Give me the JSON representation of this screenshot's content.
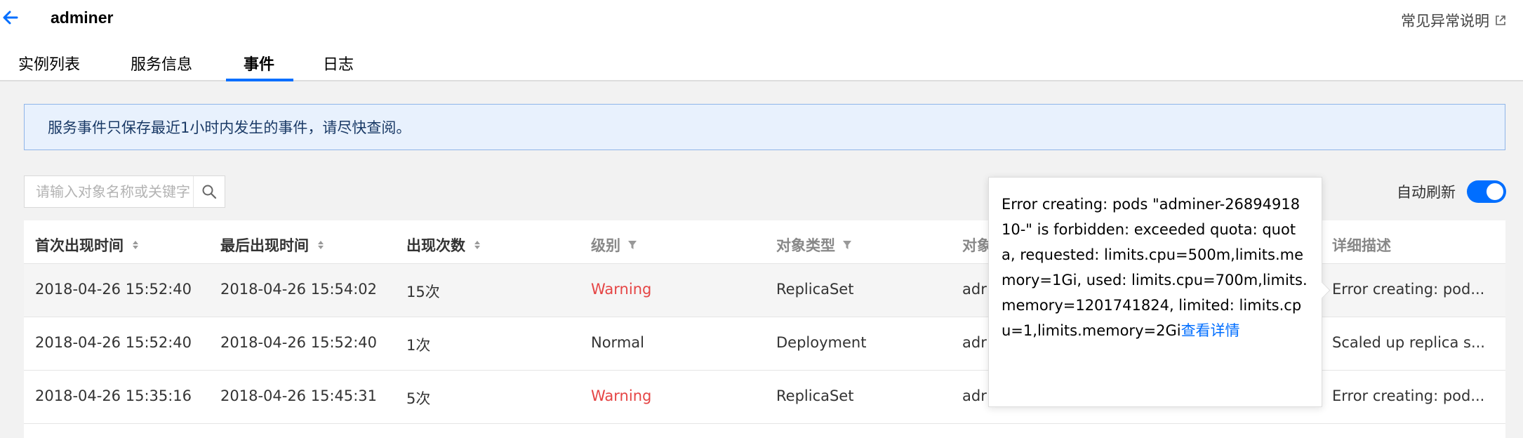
{
  "header": {
    "title": "adminer",
    "help_link": "常见异常说明"
  },
  "tabs": [
    {
      "label": "实例列表"
    },
    {
      "label": "服务信息"
    },
    {
      "label": "事件",
      "active": true
    },
    {
      "label": "日志"
    }
  ],
  "notice": "服务事件只保存最近1小时内发生的事件，请尽快查阅。",
  "search": {
    "placeholder": "请输入对象名称或关键字",
    "value": ""
  },
  "auto_refresh": {
    "label": "自动刷新",
    "enabled": true
  },
  "table": {
    "columns": [
      "首次出现时间",
      "最后出现时间",
      "出现次数",
      "级别",
      "对象类型",
      "对象",
      "详细描述"
    ],
    "rows": [
      {
        "first_seen": "2018-04-26 15:52:40",
        "last_seen": "2018-04-26 15:54:02",
        "count": "15次",
        "level": "Warning",
        "kind": "ReplicaSet",
        "object": "adr",
        "desc": "Error creating: pod..."
      },
      {
        "first_seen": "2018-04-26 15:52:40",
        "last_seen": "2018-04-26 15:52:40",
        "count": "1次",
        "level": "Normal",
        "kind": "Deployment",
        "object": "adr",
        "desc": "Scaled up replica s..."
      },
      {
        "first_seen": "2018-04-26 15:35:16",
        "last_seen": "2018-04-26 15:45:31",
        "count": "5次",
        "level": "Warning",
        "kind": "ReplicaSet",
        "object": "adr",
        "desc": "Error creating: pod..."
      }
    ]
  },
  "tooltip": {
    "text": "Error creating: pods \"adminer-2689491810-\" is forbidden: exceeded quota: quota, requested: limits.cpu=500m,limits.memory=1Gi, used: limits.cpu=700m,limits.memory=1201741824, limited: limits.cpu=1,limits.memory=2Gi",
    "link": "查看详情"
  },
  "colors": {
    "accent": "#006eff",
    "warning": "#e54545",
    "notice_bg": "#e8f1fd"
  }
}
